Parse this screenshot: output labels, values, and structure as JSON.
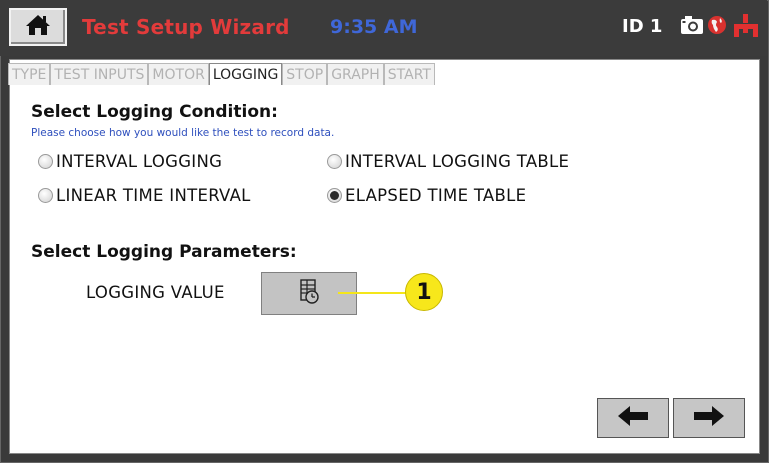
{
  "header": {
    "title": "Test Setup Wizard",
    "time": "9:35 AM",
    "id_label": "ID 1",
    "home_icon": "home-icon",
    "camera_icon": "camera-icon",
    "globe_icon": "globe-icon",
    "network_icon": "network-icon",
    "colors": {
      "title": "#e23b3b",
      "time": "#3f67d8",
      "bar": "#3b3b3b"
    }
  },
  "tabs": [
    {
      "label": "TYPE",
      "active": false
    },
    {
      "label": "TEST INPUTS",
      "active": false
    },
    {
      "label": "MOTOR",
      "active": false
    },
    {
      "label": "LOGGING",
      "active": true
    },
    {
      "label": "STOP",
      "active": false
    },
    {
      "label": "GRAPH",
      "active": false
    },
    {
      "label": "START",
      "active": false
    }
  ],
  "condition": {
    "heading": "Select Logging Condition:",
    "hint": "Please choose how you would like the test to record data.",
    "options": [
      {
        "label": "INTERVAL LOGGING",
        "selected": false
      },
      {
        "label": "INTERVAL LOGGING TABLE",
        "selected": false
      },
      {
        "label": "LINEAR TIME INTERVAL",
        "selected": false
      },
      {
        "label": "ELAPSED TIME TABLE",
        "selected": true
      }
    ]
  },
  "parameters": {
    "heading": "Select Logging Parameters:",
    "logging_value_label": "LOGGING VALUE",
    "logging_value_icon": "table-clock-icon"
  },
  "callout": {
    "number": "1",
    "color": "#f7e71b"
  },
  "nav": {
    "back_icon": "arrow-left-icon",
    "next_icon": "arrow-right-icon"
  }
}
